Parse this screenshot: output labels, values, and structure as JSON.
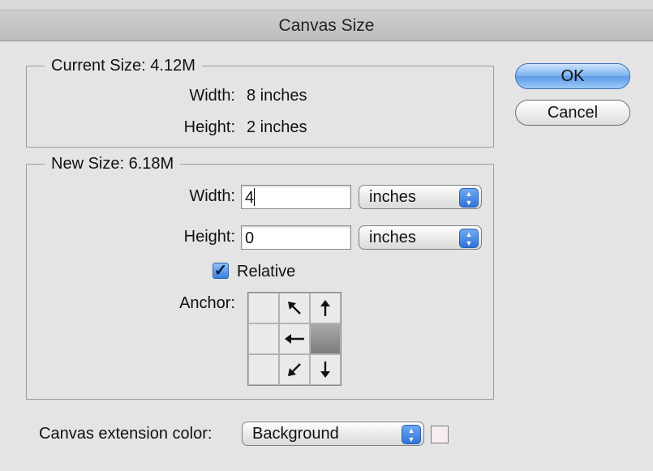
{
  "window": {
    "title": "Canvas Size"
  },
  "current_size": {
    "legend": "Current Size: 4.12M",
    "width_label": "Width:",
    "width_value": "8 inches",
    "height_label": "Height:",
    "height_value": "2 inches"
  },
  "new_size": {
    "legend": "New Size: 6.18M",
    "width_label": "Width:",
    "width_value": "4",
    "width_unit": "inches",
    "height_label": "Height:",
    "height_value": "0",
    "height_unit": "inches",
    "relative_label": "Relative",
    "relative_checked": true,
    "anchor_label": "Anchor:",
    "anchor_selected": "right-center",
    "anchor_icons": [
      "",
      "arrow-up-left-icon",
      "arrow-up-icon",
      "",
      "arrow-left-icon",
      "",
      "",
      "arrow-down-left-icon",
      "arrow-down-icon"
    ]
  },
  "extension": {
    "label": "Canvas extension color:",
    "value": "Background",
    "swatch_color": "#f6eeee"
  },
  "buttons": {
    "ok": "OK",
    "cancel": "Cancel"
  }
}
